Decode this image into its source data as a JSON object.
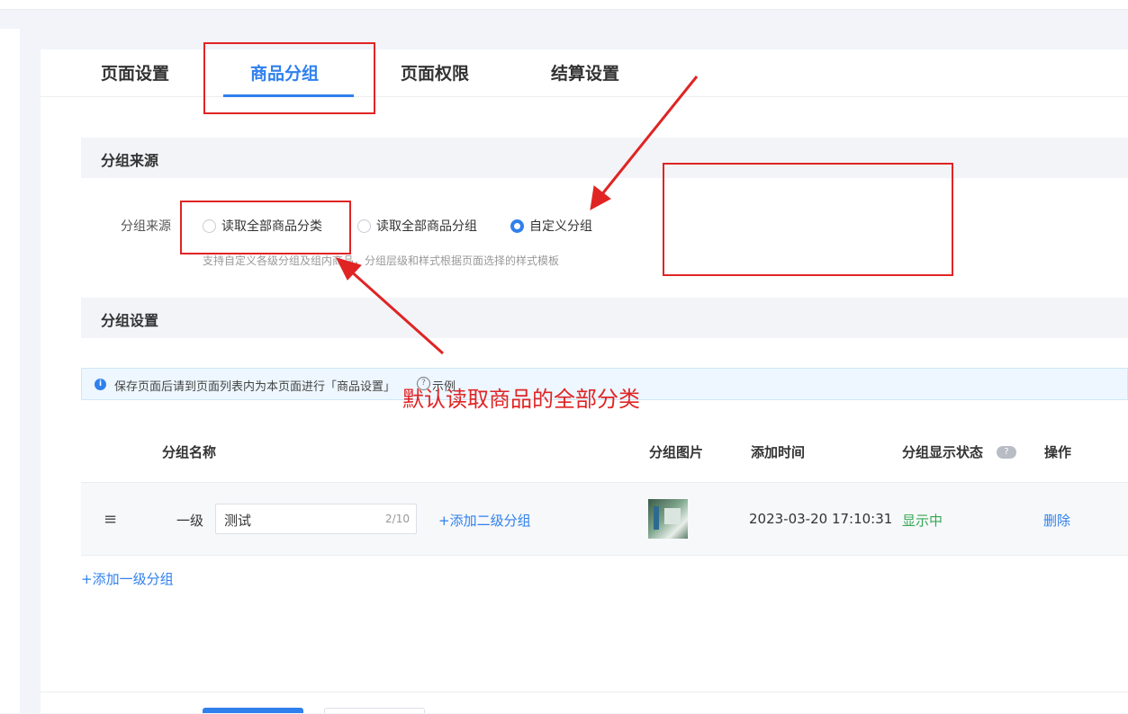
{
  "tabs": [
    {
      "label": "页面设置",
      "active": false
    },
    {
      "label": "商品分组",
      "active": true
    },
    {
      "label": "页面权限",
      "active": false
    },
    {
      "label": "结算设置",
      "active": false
    }
  ],
  "source_section": {
    "title": "分组来源",
    "field_label": "分组来源",
    "options": [
      {
        "label": "读取全部商品分类",
        "selected": false
      },
      {
        "label": "读取全部商品分组",
        "selected": false
      },
      {
        "label": "自定义分组",
        "selected": true
      }
    ],
    "hint": "支持自定义各级分组及组内商品，分组层级和样式根据页面选择的样式模板"
  },
  "settings_section": {
    "title": "分组设置",
    "alert_text": "保存页面后请到页面列表内为本页面进行「商品设置」",
    "alert_example": "示例"
  },
  "table": {
    "headers": {
      "name": "分组名称",
      "image": "分组图片",
      "time": "添加时间",
      "status": "分组显示状态",
      "action": "操作"
    },
    "rows": [
      {
        "level": "一级",
        "name": "测试",
        "count": "2/10",
        "add_sub": "+添加二级分组",
        "time": "2023-03-20 17:10:31",
        "status": "显示中",
        "action": "删除"
      }
    ],
    "add_top": "+添加一级分组"
  },
  "annotation": {
    "text": "默认读取商品的全部分类",
    "color": "#e02424"
  },
  "colors": {
    "accent": "#2f80ed",
    "status_green": "#34a853",
    "annotation_red": "#e02424"
  }
}
